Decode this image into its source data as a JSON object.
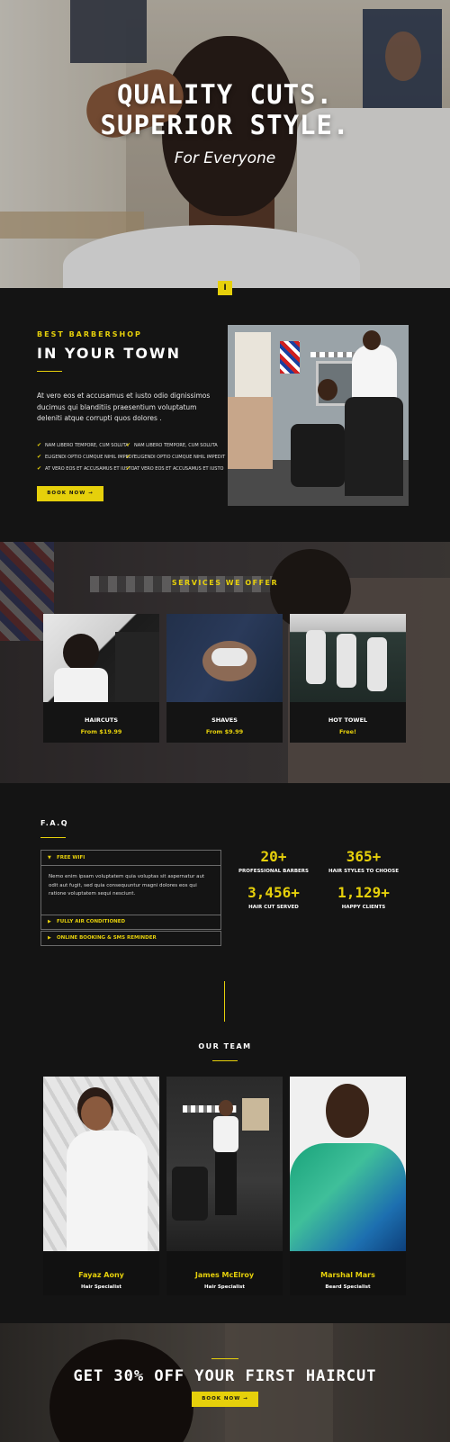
{
  "hero": {
    "title_line1": "QUALITY CUTS.",
    "title_line2": "SUPERIOR STYLE.",
    "subtitle": "For Everyone",
    "scroll_icon": "I"
  },
  "about": {
    "eyebrow": "BEST BARBERSHOP",
    "title": "IN YOUR TOWN",
    "text": "At vero eos et accusamus et iusto odio dignissimos ducimus qui blanditiis praesentium voluptatum deleniti atque corrupti quos dolores .",
    "features": [
      "NAM LIBERO TEMPORE, CUM SOLUTA",
      "NAM LIBERO TEMPORE, CUM SOLUTA",
      "ELIGENDI OPTIO CUMQUE NIHIL IMPEDIT",
      "ELIGENDI OPTIO CUMQUE NIHIL IMPEDIT",
      "AT VERO EOS ET ACCUSAMUS ET IUSTO",
      "AT VERO EOS ET ACCUSAMUS ET IUSTO"
    ],
    "check_icon": "check-icon",
    "button_label": "BOOK NOW →"
  },
  "services": {
    "title": "SERVICES WE OFFER",
    "items": [
      {
        "name": "HAIRCUTS",
        "price": "From $19.99"
      },
      {
        "name": "SHAVES",
        "price": "From $9.99"
      },
      {
        "name": "HOT TOWEL",
        "price": "Free!"
      }
    ]
  },
  "faq": {
    "title": "F.A.Q",
    "open_item": {
      "label": "FREE WIFI",
      "body": "Nemo enim ipsam voluptatem quia voluptas sit aspernatur aut odit aut fugit, sed quia consequuntur magni dolores eos qui ratione voluptatem sequi nesciunt."
    },
    "items": [
      "FULLY AIR CONDITIONED",
      "ONLINE BOOKING & SMS REMINDER"
    ],
    "arrow_open": "▼",
    "arrow_closed": "▶"
  },
  "stats": [
    {
      "value": "20+",
      "label": "PROFESSIONAL BARBERS"
    },
    {
      "value": "365+",
      "label": "HAIR STYLES TO CHOOSE"
    },
    {
      "value": "3,456+",
      "label": "HAIR CUT SERVED"
    },
    {
      "value": "1,129+",
      "label": "HAPPY CLIENTS"
    }
  ],
  "team": {
    "title": "OUR TEAM",
    "members": [
      {
        "name": "Fayaz Aony",
        "role": "Hair Specialist"
      },
      {
        "name": "James McElroy",
        "role": "Hair Specialist"
      },
      {
        "name": "Marshal Mars",
        "role": "Beard Specialist"
      }
    ]
  },
  "promo": {
    "title": "GET 30% OFF YOUR FIRST HAIRCUT",
    "button_label": "BOOK NOW →"
  },
  "colors": {
    "accent": "#e6d00b",
    "background": "#141414",
    "card": "#111111"
  }
}
